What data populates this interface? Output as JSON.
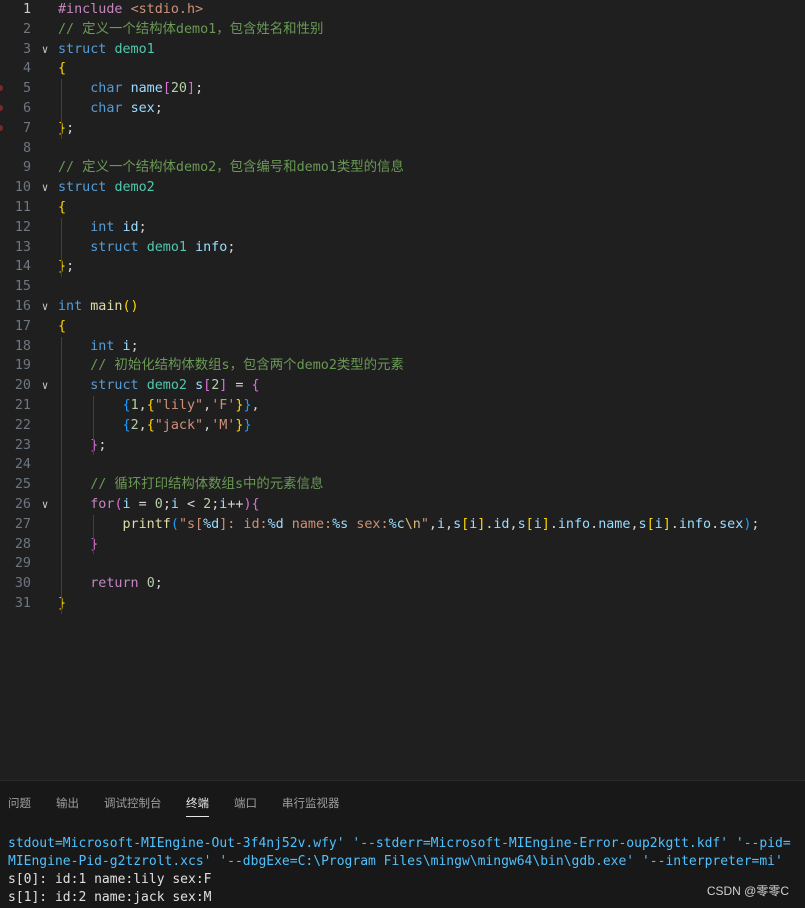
{
  "editor": {
    "lines": [
      {
        "n": "1",
        "active": true,
        "fold": false,
        "bp": false,
        "t": [
          [
            "#include",
            "pp"
          ],
          [
            " ",
            "pl"
          ],
          [
            "<stdio.h>",
            "st"
          ]
        ]
      },
      {
        "n": "2",
        "fold": false,
        "t": [
          [
            "// 定义一个结构体demo1，包含姓名和性别",
            "cm"
          ]
        ]
      },
      {
        "n": "3",
        "fold": true,
        "t": [
          [
            "struct",
            "kw"
          ],
          [
            " ",
            "pl"
          ],
          [
            "demo1",
            "ty"
          ]
        ]
      },
      {
        "n": "4",
        "fold": false,
        "t": [
          [
            "{",
            "b1"
          ]
        ]
      },
      {
        "n": "5",
        "fold": false,
        "bp": true,
        "t": [
          [
            "    ",
            "pl"
          ],
          [
            "char",
            "kw"
          ],
          [
            " ",
            "pl"
          ],
          [
            "name",
            "va"
          ],
          [
            "[",
            "b2"
          ],
          [
            "20",
            "nu"
          ],
          [
            "]",
            "b2"
          ],
          [
            ";",
            "pl"
          ]
        ]
      },
      {
        "n": "6",
        "fold": false,
        "bp": true,
        "t": [
          [
            "    ",
            "pl"
          ],
          [
            "char",
            "kw"
          ],
          [
            " ",
            "pl"
          ],
          [
            "sex",
            "va"
          ],
          [
            ";",
            "pl"
          ]
        ]
      },
      {
        "n": "7",
        "fold": false,
        "bp": true,
        "t": [
          [
            "}",
            "b1"
          ],
          [
            ";",
            "pl"
          ]
        ]
      },
      {
        "n": "8",
        "fold": false,
        "t": []
      },
      {
        "n": "9",
        "fold": false,
        "t": [
          [
            "// 定义一个结构体demo2，包含编号和demo1类型的信息",
            "cm"
          ]
        ]
      },
      {
        "n": "10",
        "fold": true,
        "t": [
          [
            "struct",
            "kw"
          ],
          [
            " ",
            "pl"
          ],
          [
            "demo2",
            "ty"
          ]
        ]
      },
      {
        "n": "11",
        "fold": false,
        "t": [
          [
            "{",
            "b1"
          ]
        ]
      },
      {
        "n": "12",
        "fold": false,
        "t": [
          [
            "    ",
            "pl"
          ],
          [
            "int",
            "kw"
          ],
          [
            " ",
            "pl"
          ],
          [
            "id",
            "va"
          ],
          [
            ";",
            "pl"
          ]
        ]
      },
      {
        "n": "13",
        "fold": false,
        "t": [
          [
            "    ",
            "pl"
          ],
          [
            "struct",
            "kw"
          ],
          [
            " ",
            "pl"
          ],
          [
            "demo1",
            "ty"
          ],
          [
            " ",
            "pl"
          ],
          [
            "info",
            "va"
          ],
          [
            ";",
            "pl"
          ]
        ]
      },
      {
        "n": "14",
        "fold": false,
        "t": [
          [
            "}",
            "b1"
          ],
          [
            ";",
            "pl"
          ]
        ]
      },
      {
        "n": "15",
        "fold": false,
        "t": []
      },
      {
        "n": "16",
        "fold": true,
        "t": [
          [
            "int",
            "kw"
          ],
          [
            " ",
            "pl"
          ],
          [
            "main",
            "fn"
          ],
          [
            "()",
            "b1"
          ]
        ]
      },
      {
        "n": "17",
        "fold": false,
        "t": [
          [
            "{",
            "b1"
          ]
        ]
      },
      {
        "n": "18",
        "fold": false,
        "t": [
          [
            "    ",
            "pl"
          ],
          [
            "int",
            "kw"
          ],
          [
            " ",
            "pl"
          ],
          [
            "i",
            "va"
          ],
          [
            ";",
            "pl"
          ]
        ]
      },
      {
        "n": "19",
        "fold": false,
        "t": [
          [
            "    ",
            "pl"
          ],
          [
            "// 初始化结构体数组s，包含两个demo2类型的元素",
            "cm"
          ]
        ]
      },
      {
        "n": "20",
        "fold": true,
        "t": [
          [
            "    ",
            "pl"
          ],
          [
            "struct",
            "kw"
          ],
          [
            " ",
            "pl"
          ],
          [
            "demo2",
            "ty"
          ],
          [
            " ",
            "pl"
          ],
          [
            "s",
            "va"
          ],
          [
            "[",
            "b2"
          ],
          [
            "2",
            "nu"
          ],
          [
            "]",
            "b2"
          ],
          [
            " = ",
            "pl"
          ],
          [
            "{",
            "b2"
          ]
        ]
      },
      {
        "n": "21",
        "fold": false,
        "t": [
          [
            "        ",
            "pl"
          ],
          [
            "{",
            "b3"
          ],
          [
            "1",
            "nu"
          ],
          [
            ",",
            "pl"
          ],
          [
            "{",
            "b1"
          ],
          [
            "\"lily\"",
            "st"
          ],
          [
            ",",
            "pl"
          ],
          [
            "'F'",
            "st"
          ],
          [
            "}",
            "b1"
          ],
          [
            "}",
            "b3"
          ],
          [
            ",",
            "pl"
          ]
        ]
      },
      {
        "n": "22",
        "fold": false,
        "t": [
          [
            "        ",
            "pl"
          ],
          [
            "{",
            "b3"
          ],
          [
            "2",
            "nu"
          ],
          [
            ",",
            "pl"
          ],
          [
            "{",
            "b1"
          ],
          [
            "\"jack\"",
            "st"
          ],
          [
            ",",
            "pl"
          ],
          [
            "'M'",
            "st"
          ],
          [
            "}",
            "b1"
          ],
          [
            "}",
            "b3"
          ]
        ]
      },
      {
        "n": "23",
        "fold": false,
        "t": [
          [
            "    ",
            "pl"
          ],
          [
            "}",
            "b2"
          ],
          [
            ";",
            "pl"
          ]
        ]
      },
      {
        "n": "24",
        "fold": false,
        "t": []
      },
      {
        "n": "25",
        "fold": false,
        "t": [
          [
            "    ",
            "pl"
          ],
          [
            "// 循环打印结构体数组s中的元素信息",
            "cm"
          ]
        ]
      },
      {
        "n": "26",
        "fold": true,
        "t": [
          [
            "    ",
            "pl"
          ],
          [
            "for",
            "ctl"
          ],
          [
            "(",
            "b2"
          ],
          [
            "i",
            "va"
          ],
          [
            " = ",
            "pl"
          ],
          [
            "0",
            "nu"
          ],
          [
            ";",
            "pl"
          ],
          [
            "i",
            "va"
          ],
          [
            " < ",
            "pl"
          ],
          [
            "2",
            "nu"
          ],
          [
            ";",
            "pl"
          ],
          [
            "i",
            "va"
          ],
          [
            "++",
            "pl"
          ],
          [
            ")",
            "b2"
          ],
          [
            "{",
            "b2"
          ]
        ]
      },
      {
        "n": "27",
        "fold": false,
        "t": [
          [
            "        ",
            "pl"
          ],
          [
            "printf",
            "fn"
          ],
          [
            "(",
            "b3"
          ],
          [
            "\"s[",
            "st"
          ],
          [
            "%d",
            "va"
          ],
          [
            "]: id:",
            "st"
          ],
          [
            "%d",
            "va"
          ],
          [
            " name:",
            "st"
          ],
          [
            "%s",
            "va"
          ],
          [
            " sex:",
            "st"
          ],
          [
            "%c",
            "va"
          ],
          [
            "\\n",
            "esc"
          ],
          [
            "\"",
            "st"
          ],
          [
            ",",
            "pl"
          ],
          [
            "i",
            "va"
          ],
          [
            ",",
            "pl"
          ],
          [
            "s",
            "va"
          ],
          [
            "[",
            "b1"
          ],
          [
            "i",
            "va"
          ],
          [
            "]",
            "b1"
          ],
          [
            ".",
            "pl"
          ],
          [
            "id",
            "va"
          ],
          [
            ",",
            "pl"
          ],
          [
            "s",
            "va"
          ],
          [
            "[",
            "b1"
          ],
          [
            "i",
            "va"
          ],
          [
            "]",
            "b1"
          ],
          [
            ".",
            "pl"
          ],
          [
            "info",
            "va"
          ],
          [
            ".",
            "pl"
          ],
          [
            "name",
            "va"
          ],
          [
            ",",
            "pl"
          ],
          [
            "s",
            "va"
          ],
          [
            "[",
            "b1"
          ],
          [
            "i",
            "va"
          ],
          [
            "]",
            "b1"
          ],
          [
            ".",
            "pl"
          ],
          [
            "info",
            "va"
          ],
          [
            ".",
            "pl"
          ],
          [
            "sex",
            "va"
          ],
          [
            ")",
            "b3"
          ],
          [
            ";",
            "pl"
          ]
        ]
      },
      {
        "n": "28",
        "fold": false,
        "t": [
          [
            "    ",
            "pl"
          ],
          [
            "}",
            "b2"
          ]
        ]
      },
      {
        "n": "29",
        "fold": false,
        "t": []
      },
      {
        "n": "30",
        "fold": false,
        "t": [
          [
            "    ",
            "pl"
          ],
          [
            "return",
            "ctl"
          ],
          [
            " ",
            "pl"
          ],
          [
            "0",
            "nu"
          ],
          [
            ";",
            "pl"
          ]
        ]
      },
      {
        "n": "31",
        "fold": false,
        "t": [
          [
            "}",
            "b1"
          ]
        ]
      }
    ]
  },
  "panel": {
    "tabs": [
      {
        "label": "问题",
        "active": false,
        "name": "tab-problems"
      },
      {
        "label": "输出",
        "active": false,
        "name": "tab-output"
      },
      {
        "label": "调试控制台",
        "active": false,
        "name": "tab-debug-console"
      },
      {
        "label": "终端",
        "active": true,
        "name": "tab-terminal"
      },
      {
        "label": "端口",
        "active": false,
        "name": "tab-ports"
      },
      {
        "label": "串行监视器",
        "active": false,
        "name": "tab-serial-monitor"
      }
    ],
    "terminal": [
      {
        "text": "stdout=Microsoft-MIEngine-Out-3f4nj52v.wfy' '--stderr=Microsoft-MIEngine-Error-oup2kgtt.kdf' '--pid=",
        "out": false
      },
      {
        "text": "MIEngine-Pid-g2tzrolt.xcs' '--dbgExe=C:\\Program Files\\mingw\\mingw64\\bin\\gdb.exe' '--interpreter=mi'",
        "out": false
      },
      {
        "text": "s[0]: id:1 name:lily sex:F",
        "out": true
      },
      {
        "text": "s[1]: id:2 name:jack sex:M",
        "out": true
      }
    ]
  },
  "watermark": "CSDN @零零C",
  "colors": {
    "background": "#1f1f1f",
    "keyword": "#569cd6",
    "type": "#4ec9b0",
    "comment": "#6a9955",
    "string": "#ce9178",
    "terminal_text": "#4fc1ff"
  }
}
